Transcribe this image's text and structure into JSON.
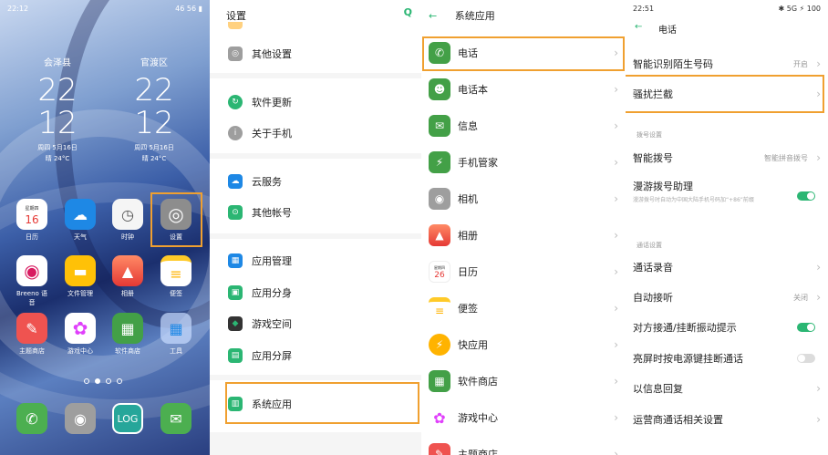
{
  "home": {
    "status_time": "22:12",
    "status_right": "46 56 ▮",
    "clocks": [
      {
        "city": "会泽县",
        "hour": "22",
        "min": "12",
        "date": "周四  5月16日",
        "weather": "晴 24°C"
      },
      {
        "city": "官渡区",
        "hour": "22",
        "min": "12",
        "date": "周四  5月16日",
        "weather": "晴 24°C"
      }
    ],
    "apps_row1": [
      {
        "label": "日历",
        "glyph": "16",
        "sub": "星期四",
        "color": "#ffffff"
      },
      {
        "label": "天气",
        "glyph": "☁",
        "color": "#1e88e5"
      },
      {
        "label": "时钟",
        "glyph": "◷",
        "color": "#f5f5f5"
      },
      {
        "label": "设置",
        "glyph": "◎",
        "color": "#9e9e9e"
      }
    ],
    "apps_row2": [
      {
        "label": "Breeno 语音",
        "glyph": "◉",
        "color": "#ffffff"
      },
      {
        "label": "文件管理",
        "glyph": "▬",
        "color": "#ffc107"
      },
      {
        "label": "相册",
        "glyph": "▲",
        "color": "#ff7043"
      },
      {
        "label": "便签",
        "glyph": "≡",
        "color": "#ffffff"
      }
    ],
    "apps_row3": [
      {
        "label": "主题商店",
        "glyph": "✎",
        "color": "#ef5350"
      },
      {
        "label": "游戏中心",
        "glyph": "✿",
        "color": "#ffffff"
      },
      {
        "label": "软件商店",
        "glyph": "▦",
        "color": "#43a047"
      },
      {
        "label": "工具",
        "glyph": "▦",
        "color": "#90caf9"
      }
    ],
    "dock": [
      {
        "glyph": "✆",
        "color": "#4caf50"
      },
      {
        "glyph": "◉",
        "color": "#9e9e9e"
      },
      {
        "glyph": "LOG",
        "color": "#26a69a"
      },
      {
        "glyph": "✉",
        "color": "#4caf50"
      }
    ]
  },
  "settings": {
    "title": "设置",
    "search_icon": "Q",
    "items": [
      {
        "label": "其他设置",
        "color": "#9e9e9e",
        "glyph": "◎"
      },
      {
        "label": "软件更新",
        "color": "#2bb673",
        "glyph": "↻"
      },
      {
        "label": "关于手机",
        "color": "#9e9e9e",
        "glyph": "i"
      },
      {
        "label": "云服务",
        "color": "#1e88e5",
        "glyph": "☁"
      },
      {
        "label": "其他帐号",
        "color": "#2bb673",
        "glyph": "⊙"
      },
      {
        "label": "应用管理",
        "color": "#1e88e5",
        "glyph": "▦"
      },
      {
        "label": "应用分身",
        "color": "#2bb673",
        "glyph": "▣"
      },
      {
        "label": "游戏空间",
        "color": "#333333",
        "glyph": "◆"
      },
      {
        "label": "应用分屏",
        "color": "#2bb673",
        "glyph": "▤"
      },
      {
        "label": "系统应用",
        "color": "#2bb673",
        "glyph": "▥"
      }
    ]
  },
  "system_apps": {
    "title": "系统应用",
    "back": "←",
    "items": [
      {
        "label": "电话",
        "color": "#43a047",
        "glyph": "✆"
      },
      {
        "label": "电话本",
        "color": "#43a047",
        "glyph": "☻"
      },
      {
        "label": "信息",
        "color": "#43a047",
        "glyph": "✉"
      },
      {
        "label": "手机管家",
        "color": "#43a047",
        "glyph": "⚡"
      },
      {
        "label": "相机",
        "color": "#9e9e9e",
        "glyph": "◉"
      },
      {
        "label": "相册",
        "color": "#ff7043",
        "glyph": "▲"
      },
      {
        "label": "日历",
        "color": "#ffffff",
        "glyph": "26",
        "sub": "星期四"
      },
      {
        "label": "便签",
        "color": "#ffca28",
        "glyph": "≡"
      },
      {
        "label": "快应用",
        "color": "#ffb300",
        "glyph": "⚡"
      },
      {
        "label": "软件商店",
        "color": "#43a047",
        "glyph": "▦"
      },
      {
        "label": "游戏中心",
        "color": "#ffffff",
        "glyph": "✿"
      },
      {
        "label": "主题商店",
        "color": "#ef5350",
        "glyph": "✎"
      }
    ]
  },
  "phone": {
    "status_time": "22:51",
    "status_right": "✱ 5G ⚡ 100",
    "title": "电话",
    "back": "←",
    "row_recognize": {
      "label": "智能识别陌生号码",
      "value": "开启"
    },
    "row_block": {
      "label": "骚扰拦截"
    },
    "section_dial": "拨号设置",
    "row_smart_dial": {
      "label": "智能拨号",
      "value": "智能拼音拨号"
    },
    "row_roaming": {
      "label": "漫游拨号助理",
      "sub": "漫游拨号时自动为中国大陆手机号码加“+86”前缀"
    },
    "section_call": "通话设置",
    "row_record": {
      "label": "通话录音"
    },
    "row_autoanswer": {
      "label": "自动接听",
      "value": "关闭"
    },
    "row_vibrate": {
      "label": "对方接通/挂断振动提示"
    },
    "row_power_hangup": {
      "label": "亮屏时按电源键挂断通话"
    },
    "row_reply": {
      "label": "以信息回复"
    },
    "row_carrier": {
      "label": "运营商通话相关设置"
    }
  }
}
